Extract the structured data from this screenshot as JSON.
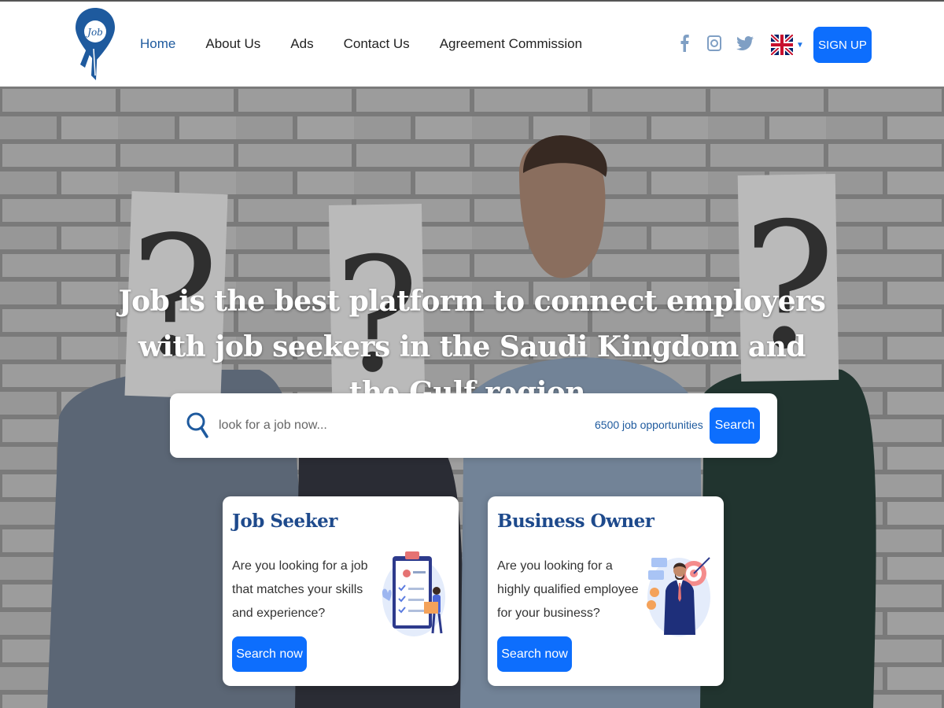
{
  "nav": {
    "links": [
      {
        "label": "Home",
        "active": true
      },
      {
        "label": "About Us"
      },
      {
        "label": "Ads"
      },
      {
        "label": "Contact Us"
      },
      {
        "label": "Agreement Commission"
      }
    ],
    "logo_text": "Job",
    "social_icons": [
      "facebook-icon",
      "instagram-icon",
      "twitter-icon"
    ],
    "language_flag": "uk-flag-icon",
    "signup_label": "SIGN UP"
  },
  "hero": {
    "title": "Job is the best platform to connect employers with job seekers in the Saudi Kingdom and the Gulf region.",
    "search": {
      "placeholder": "look for a job now...",
      "count_text": "6500 job opportunities",
      "button_label": "Search"
    },
    "cards": [
      {
        "title": "Job Seeker",
        "text": "Are you looking for a job that matches your skills and experience?",
        "button_label": "Search now",
        "illustration": "resume-clipboard-illustration"
      },
      {
        "title": "Business Owner",
        "text": "Are you looking for a highly qualified employee for your business?",
        "button_label": "Search now",
        "illustration": "businessman-target-illustration"
      }
    ]
  },
  "colors": {
    "primary": "#0d6efd",
    "brand_dark": "#1e4a8c",
    "nav_active": "#1e5a9e"
  }
}
